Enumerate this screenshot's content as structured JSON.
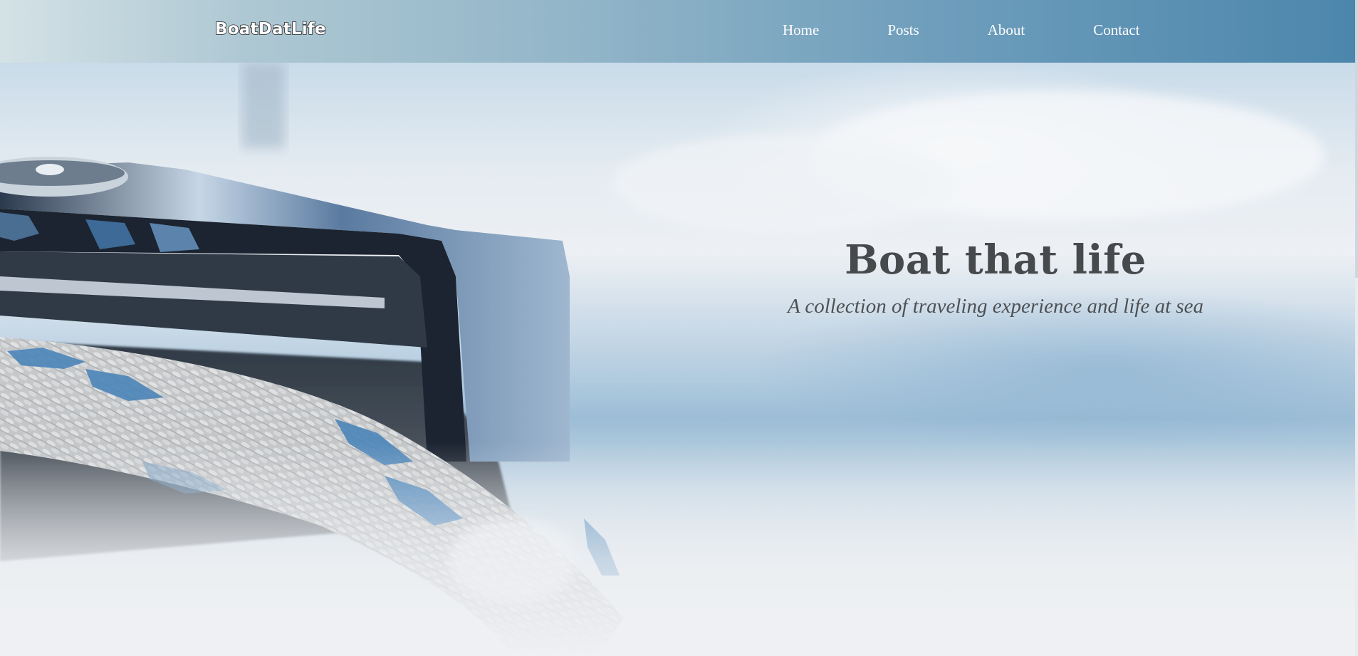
{
  "navbar": {
    "brand": "BoatDatLife",
    "links": [
      {
        "label": "Home"
      },
      {
        "label": "Posts"
      },
      {
        "label": "About"
      },
      {
        "label": "Contact"
      }
    ]
  },
  "hero": {
    "title": "Boat that life",
    "subtitle": "A collection of traveling experience and life at sea"
  },
  "colors": {
    "nav_gradient_start": "#d4e2e6",
    "nav_gradient_end": "#4c86ac",
    "title_text": "#474a4d",
    "rope_accent_blue": "#4a84b8"
  }
}
